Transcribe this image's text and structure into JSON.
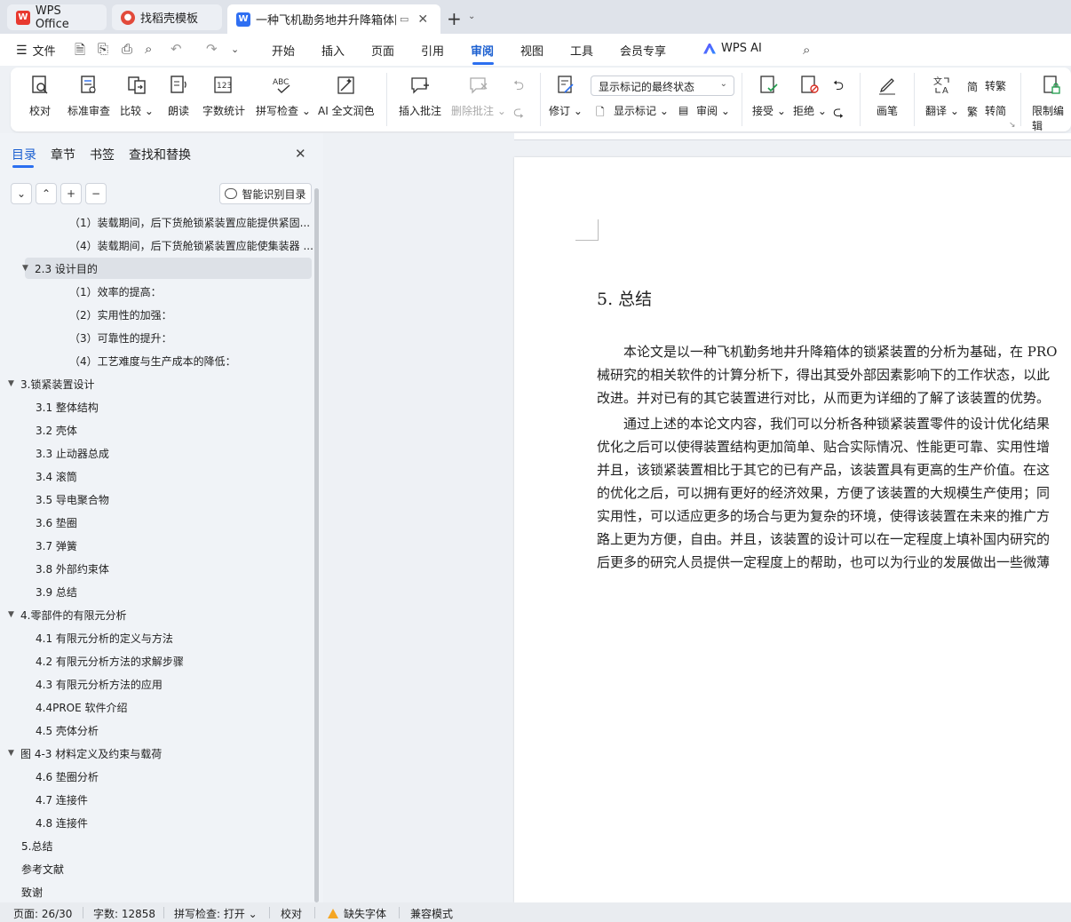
{
  "tabs": [
    {
      "label": "WPS Office",
      "icon": "wps-logo-icon"
    },
    {
      "label": "找稻壳模板",
      "icon": "daoke-logo-icon"
    },
    {
      "label": "一种飞机勘务地井升降箱体限",
      "icon": "word-doc-icon"
    }
  ],
  "menubar": {
    "file": "文件",
    "items": [
      "开始",
      "插入",
      "页面",
      "引用",
      "审阅",
      "视图",
      "工具",
      "会员专享"
    ],
    "active": "审阅",
    "wps_ai": "WPS AI"
  },
  "ribbon": {
    "proofread": "校对",
    "std_review": "标准审查",
    "compare": "比较",
    "read_aloud": "朗读",
    "word_count": "字数统计",
    "spell_check": "拼写检查",
    "ai_polish": "AI 全文润色",
    "insert_comment": "插入批注",
    "delete_comment": "删除批注",
    "track_changes": "修订",
    "display_mode": "显示标记的最终状态",
    "show_markup": "显示标记",
    "review_pane": "审阅",
    "accept": "接受",
    "reject": "拒绝",
    "pen": "画笔",
    "translate": "翻译",
    "to_traditional": "转繁",
    "to_simplified": "转简",
    "restrict_edit": "限制编辑"
  },
  "nav": {
    "tabs": [
      "目录",
      "章节",
      "书签",
      "查找和替换"
    ],
    "active_tab": "目录",
    "smart_toc": "智能识别目录",
    "toc": [
      {
        "text": "（1）装载期间，后下货舱锁紧装置应能提供紧固...",
        "level": 3,
        "arrow": ""
      },
      {
        "text": "（4）装载期间，后下货舱锁紧装置应能使集装器 ...",
        "level": 3,
        "arrow": ""
      },
      {
        "text": "2.3 设计目的",
        "level": 2,
        "arrow": "▼",
        "selected": true
      },
      {
        "text": "（1）效率的提高：",
        "level": 3,
        "arrow": ""
      },
      {
        "text": "（2）实用性的加强：",
        "level": 3,
        "arrow": ""
      },
      {
        "text": "（3）可靠性的提升：",
        "level": 3,
        "arrow": ""
      },
      {
        "text": "（4）工艺难度与生产成本的降低：",
        "level": 3,
        "arrow": ""
      },
      {
        "text": "3.锁紧装置设计",
        "level": 1,
        "arrow": "▼"
      },
      {
        "text": "3.1 整体结构",
        "level": 2,
        "arrow": ""
      },
      {
        "text": "3.2 壳体",
        "level": 2,
        "arrow": ""
      },
      {
        "text": "3.3 止动器总成",
        "level": 2,
        "arrow": ""
      },
      {
        "text": "3.4 滚筒",
        "level": 2,
        "arrow": ""
      },
      {
        "text": "3.5 导电聚合物",
        "level": 2,
        "arrow": ""
      },
      {
        "text": "3.6 垫圈",
        "level": 2,
        "arrow": ""
      },
      {
        "text": "3.7 弹簧",
        "level": 2,
        "arrow": ""
      },
      {
        "text": "3.8 外部约束体",
        "level": 2,
        "arrow": ""
      },
      {
        "text": "3.9 总结",
        "level": 2,
        "arrow": ""
      },
      {
        "text": "4.零部件的有限元分析",
        "level": 1,
        "arrow": "▼"
      },
      {
        "text": "4.1 有限元分析的定义与方法",
        "level": 2,
        "arrow": ""
      },
      {
        "text": "4.2 有限元分析方法的求解步骤",
        "level": 2,
        "arrow": ""
      },
      {
        "text": "4.3 有限元分析方法的应用",
        "level": 2,
        "arrow": ""
      },
      {
        "text": "4.4PROE 软件介绍",
        "level": 2,
        "arrow": ""
      },
      {
        "text": "4.5 壳体分析",
        "level": 2,
        "arrow": ""
      },
      {
        "text": "图 4-3 材料定义及约束与载荷",
        "level": 1,
        "arrow": "▼"
      },
      {
        "text": "4.6 垫圈分析",
        "level": 2,
        "arrow": ""
      },
      {
        "text": "4.7 连接件",
        "level": 2,
        "arrow": ""
      },
      {
        "text": "4.8 连接件",
        "level": 2,
        "arrow": ""
      },
      {
        "text": "5.总结",
        "level": 1,
        "arrow": ""
      },
      {
        "text": "参考文献",
        "level": 1,
        "arrow": ""
      },
      {
        "text": "致谢",
        "level": 1,
        "arrow": ""
      }
    ]
  },
  "document": {
    "heading": "5. 总结",
    "lines": [
      "　　本论文是以一种飞机勤务地井升降箱体的锁紧装置的分析为基础，在 PRO",
      "械研究的相关软件的计算分析下，得出其受外部因素影响下的工作状态，以此",
      "改进。并对已有的其它装置进行对比，从而更为详细的了解了该装置的优势。",
      "　　通过上述的本论文内容，我们可以分析各种锁紧装置零件的设计优化结果",
      "优化之后可以使得装置结构更加简单、贴合实际情况、性能更可靠、实用性增",
      "并且，该锁紧装置相比于其它的已有产品，该装置具有更高的生产价值。在这",
      "的优化之后，可以拥有更好的经济效果，方便了该装置的大规模生产使用；同",
      "实用性，可以适应更多的场合与更为复杂的环境，使得该装置在未来的推广方",
      "路上更为方便，自由。并且，该装置的设计可以在一定程度上填补国内研究的",
      "后更多的研究人员提供一定程度上的帮助，也可以为行业的发展做出一些微薄"
    ]
  },
  "status": {
    "page": "页面: 26/30",
    "words": "字数: 12858",
    "spell": "拼写检查: 打开",
    "proof": "校对",
    "missing_font": "缺失字体",
    "compat": "兼容模式"
  },
  "colors": {
    "accent": "#2b6ff0",
    "wps_red": "#e8392f",
    "doc_blue": "#2f6ff2"
  }
}
